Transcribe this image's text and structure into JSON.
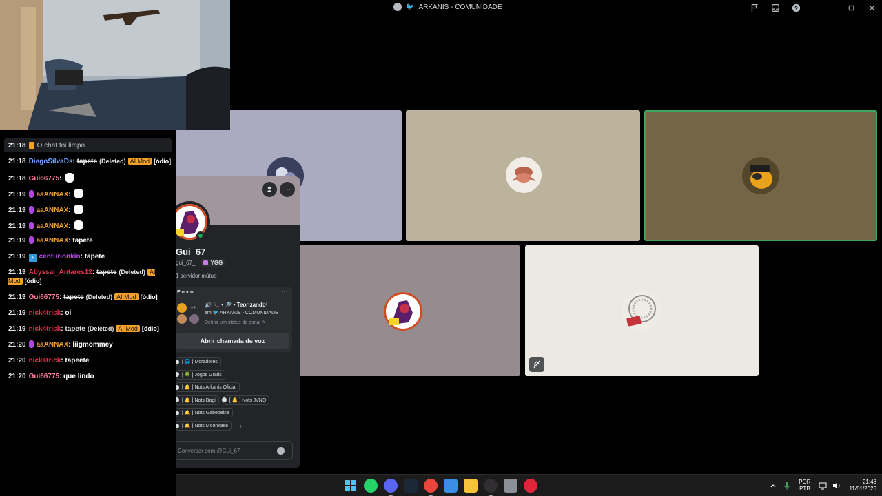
{
  "window": {
    "title": "ARKANIS - COMUNIDADE",
    "controls": [
      "minimize",
      "maximize",
      "close"
    ],
    "toolbar_icons": [
      "flag-icon",
      "inbox-icon",
      "help-icon"
    ]
  },
  "chat": {
    "system": {
      "time": "21:18",
      "text": "O chat foi limpo."
    },
    "messages": [
      {
        "time": "21:18",
        "user": "DiegoSilvaDs",
        "user_color": "#6fa7ff",
        "text": "tapete",
        "deleted_label": "(Deleted)",
        "mod_label": "AI Mod",
        "reason": "[ódio]",
        "is_deleted": true
      },
      {
        "time": "21:18",
        "user": "Gui66775",
        "user_color": "#ff7d9c",
        "emote": "ghost"
      },
      {
        "time": "21:19",
        "user": "aaANNAX",
        "user_color": "#f4a02a",
        "mic": true,
        "emote": "goose"
      },
      {
        "time": "21:19",
        "user": "aaANNAX",
        "user_color": "#f4a02a",
        "mic": true,
        "emote": "goose"
      },
      {
        "time": "21:19",
        "user": "aaANNAX",
        "user_color": "#f4a02a",
        "mic": true,
        "emote": "goose"
      },
      {
        "time": "21:19",
        "user": "aaANNAX",
        "user_color": "#f4a02a",
        "mic": true,
        "text": "tapete"
      },
      {
        "time": "21:19",
        "user": "centurionkin",
        "user_color": "#b146e6",
        "bolt": true,
        "text": "tapete"
      },
      {
        "time": "21:19",
        "user": "Abyssal_Antares12",
        "user_color": "#e0314d",
        "text": "tapete",
        "deleted_label": "(Deleted)",
        "mod_label": "AI Mod",
        "reason": "[ódio]",
        "is_deleted": true
      },
      {
        "time": "21:19",
        "user": "Gui66775",
        "user_color": "#ff7d9c",
        "text": "tapete",
        "deleted_label": "(Deleted)",
        "mod_label": "AI Mod",
        "reason": "[ódio]",
        "is_deleted": true
      },
      {
        "time": "21:19",
        "user": "nick4trick",
        "user_color": "#e0314d",
        "text": "oi"
      },
      {
        "time": "21:19",
        "user": "nick4trick",
        "user_color": "#e0314d",
        "text": "tapete",
        "deleted_label": "(Deleted)",
        "mod_label": "AI Mod",
        "reason": "[ódio]",
        "is_deleted": true
      },
      {
        "time": "21:20",
        "user": "aaANNAX",
        "user_color": "#f4a02a",
        "mic": true,
        "text": "liigmommey"
      },
      {
        "time": "21:20",
        "user": "nick4trick",
        "user_color": "#e0314d",
        "text": "tapeete"
      },
      {
        "time": "21:20",
        "user": "Gui66775",
        "user_color": "#ff7d9c",
        "text": "que lindo"
      }
    ]
  },
  "profile": {
    "display_name": "Gui_67",
    "username": "gui_67_",
    "tag": "YGG",
    "mutual": "1 servidor mútuo",
    "voice": {
      "label": "Em voz",
      "plus_count": "+2",
      "channel_title": "Teorizando³",
      "server_prefix": "em",
      "server_name": "ARKANIS - COMUNIDADE",
      "status_hint": "Definir um status do canal",
      "join_button": "Abrir chamada de voz"
    },
    "roles": [
      [
        "[ 🌐 ] Moradores"
      ],
      [
        "[ 🍀 ] Jogos Gratis"
      ],
      [
        "[ 🔔 ] Nots Arkanis Oficial"
      ],
      [
        "[ 🔔 ] Nots Bagi",
        "[ 🔔 ] Nots JVNQ"
      ],
      [
        "[ 🔔 ] Nots Gabepeixe"
      ],
      [
        "[ 🔔 ] Nots Moonkase"
      ]
    ],
    "message_placeholder": "Conversar com @Gui_67"
  },
  "taskbar": {
    "apps": [
      "windows-start",
      "whatsapp",
      "discord",
      "steam",
      "chrome",
      "photos",
      "file-explorer",
      "obs",
      "settings",
      "media-player"
    ],
    "lang_top": "POR",
    "lang_bottom": "PTB",
    "time": "21:48",
    "date": "11/01/2026"
  },
  "colors": {
    "accent_green": "#3ba55c",
    "ai_mod": "#f4a02a",
    "discord_bg": "#232428"
  }
}
